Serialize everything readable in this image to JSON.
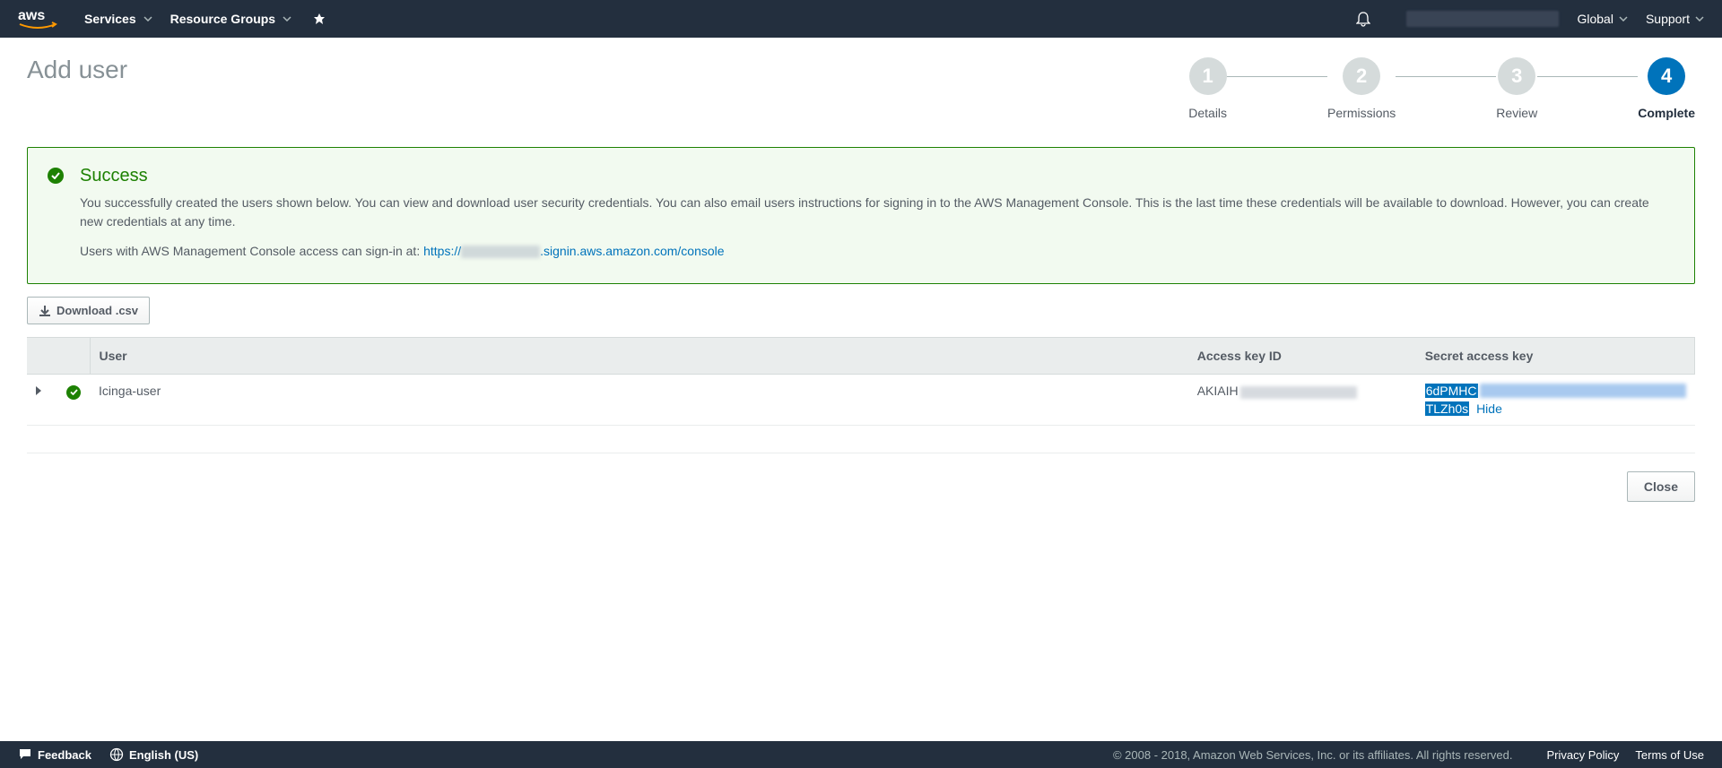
{
  "topnav": {
    "services": "Services",
    "resource_groups": "Resource Groups",
    "global": "Global",
    "support": "Support"
  },
  "page": {
    "title": "Add user"
  },
  "wizard": {
    "steps": [
      {
        "num": "1",
        "label": "Details"
      },
      {
        "num": "2",
        "label": "Permissions"
      },
      {
        "num": "3",
        "label": "Review"
      },
      {
        "num": "4",
        "label": "Complete"
      }
    ],
    "active_index": 3
  },
  "success": {
    "heading": "Success",
    "body": "You successfully created the users shown below. You can view and download user security credentials. You can also email users instructions for signing in to the AWS Management Console. This is the last time these credentials will be available to download. However, you can create new credentials at any time.",
    "signin_prefix": "Users with AWS Management Console access can sign-in at: ",
    "signin_url_prefix": "https://",
    "signin_url_suffix": ".signin.aws.amazon.com/console"
  },
  "download_label": "Download .csv",
  "table": {
    "headers": {
      "user": "User",
      "access_key": "Access key ID",
      "secret": "Secret access key"
    },
    "row": {
      "username": "Icinga-user",
      "access_key_visible": "AKIAIH",
      "secret_line1": "6dPMHC",
      "secret_line2": "TLZh0s",
      "hide_label": "Hide"
    }
  },
  "close_label": "Close",
  "footer": {
    "feedback": "Feedback",
    "language": "English (US)",
    "copyright": "© 2008 - 2018, Amazon Web Services, Inc. or its affiliates. All rights reserved.",
    "privacy": "Privacy Policy",
    "terms": "Terms of Use"
  }
}
